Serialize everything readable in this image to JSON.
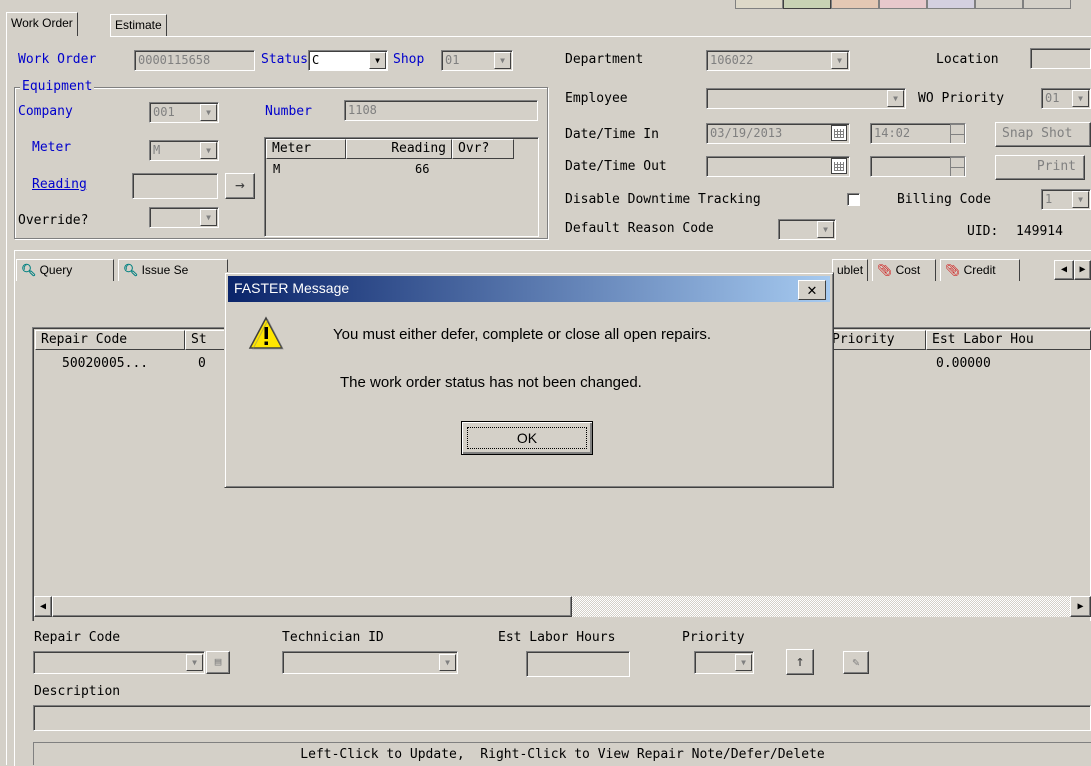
{
  "top_tabs": [
    "Work Order",
    "Estimate"
  ],
  "header": {
    "work_order_label": "Work Order",
    "work_order_value": "0000115658",
    "status_label": "Status",
    "status_value": "C",
    "shop_label": "Shop",
    "shop_value": "01",
    "department_label": "Department",
    "department_value": "106022",
    "location_label": "Location",
    "employee_label": "Employee",
    "wo_priority_label": "WO Priority",
    "wo_priority_value": "01",
    "date_in_label": "Date/Time In",
    "date_in_value": "03/19/2013",
    "time_in_value": "14:02",
    "date_out_label": "Date/Time Out",
    "snapshot_label": "Snap Shot",
    "print_label": "Print",
    "disable_downtime_label": "Disable Downtime Tracking",
    "billing_code_label": "Billing Code",
    "billing_code_value": "1",
    "default_reason_label": "Default Reason Code",
    "uid_label": "UID:",
    "uid_value": "149914"
  },
  "equipment": {
    "group_label": "Equipment",
    "company_label": "Company",
    "company_value": "001",
    "number_label": "Number",
    "number_value": "1108",
    "meter_label": "Meter",
    "meter_value": "M",
    "reading_label": "Reading",
    "override_label": "Override?",
    "arrow": "→",
    "meter_table": {
      "headers": [
        "Meter",
        "Reading",
        "Ovr?"
      ],
      "rows": [
        {
          "meter": "M",
          "reading": "66",
          "ovr": ""
        }
      ]
    }
  },
  "sub_tabs": [
    "Query",
    "Issue Se",
    "ublet",
    "Cost",
    "Credit"
  ],
  "repairs_grid": {
    "headers": [
      "Repair Code",
      "St",
      "Priority",
      "Est Labor Hou"
    ],
    "rows": [
      {
        "repair_code": "50020005...",
        "st": "0",
        "est_labor": "0.00000"
      }
    ]
  },
  "bottom": {
    "repair_code_label": "Repair Code",
    "technician_label": "Technician ID",
    "est_labor_label": "Est Labor Hours",
    "priority_label": "Priority",
    "description_label": "Description",
    "status_bar": "Left-Click to Update,  Right-Click to View Repair Note/Defer/Delete"
  },
  "dialog": {
    "title": "FASTER Message",
    "close": "✕",
    "message1": "You must either defer, complete or close all open repairs.",
    "message2": "The work order status has not been changed.",
    "ok": "OK"
  },
  "icons": {
    "query": "magnifier-icon",
    "cost": "paperclip-icon",
    "warning": "warning-icon"
  },
  "colors": {
    "label_blue": "#0000cc",
    "title_start": "#0a246a",
    "title_end": "#a6caf0",
    "face": "#d4d0c8"
  }
}
